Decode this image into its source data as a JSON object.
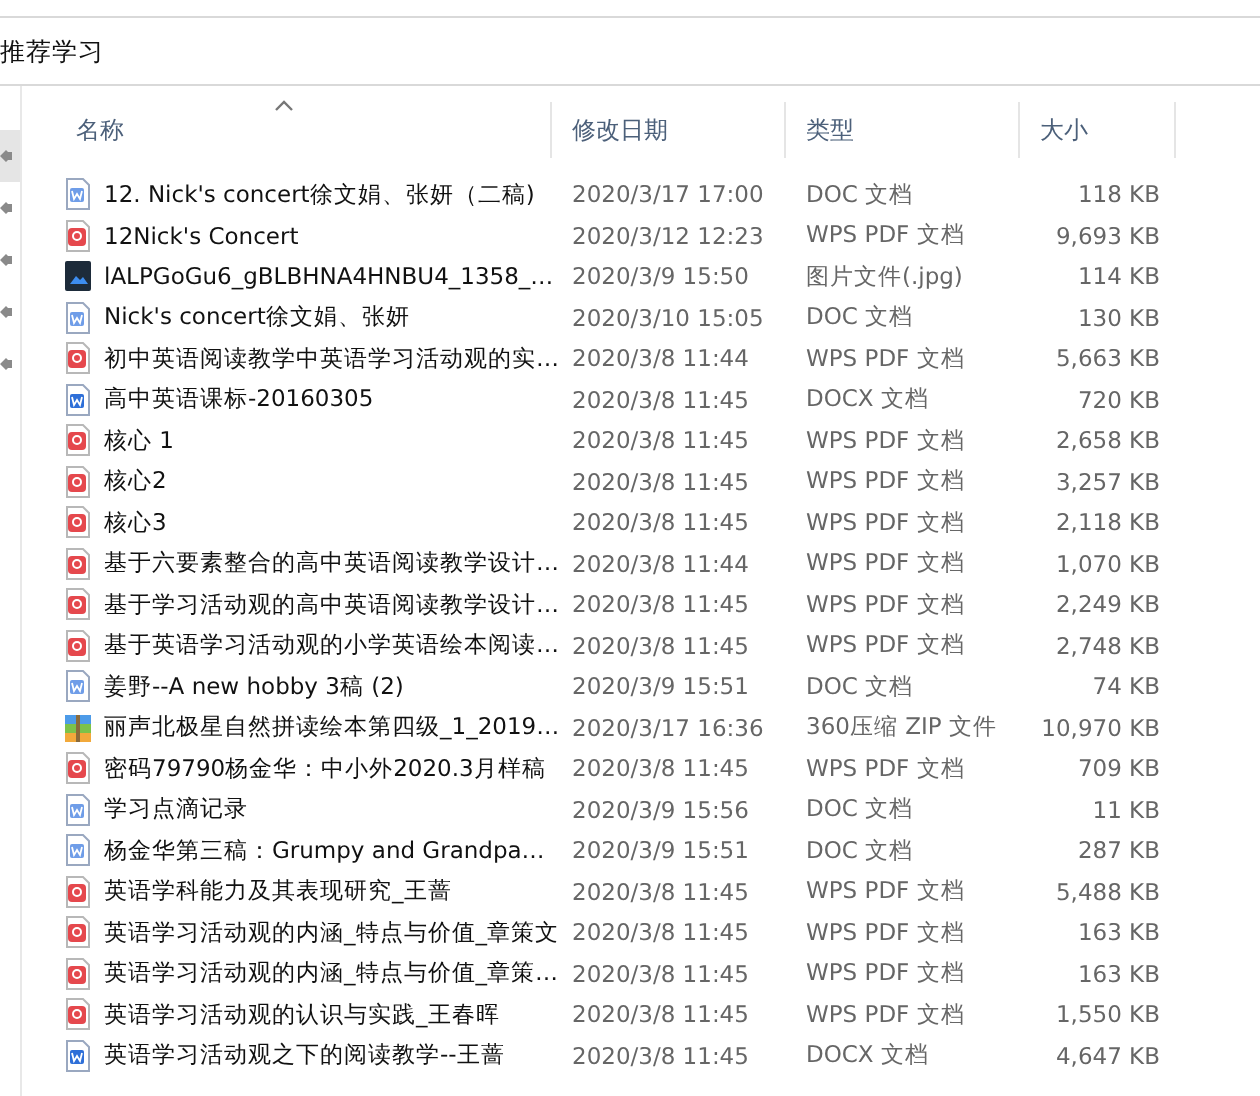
{
  "address_bar": {
    "path": "推荐学习"
  },
  "nav_pane": {
    "items": [
      {
        "selected": true
      },
      {
        "selected": false
      },
      {
        "selected": false
      },
      {
        "selected": false
      },
      {
        "selected": false
      }
    ]
  },
  "table": {
    "columns": [
      "名称",
      "修改日期",
      "类型",
      "大小"
    ],
    "rows": [
      {
        "kind": "doc",
        "name": "12. Nick's concert徐文娟、张妍（二稿)",
        "date": "2020/3/17 17:00",
        "type": "DOC 文档",
        "size": "118 KB"
      },
      {
        "kind": "pdf",
        "name": "12Nick's Concert",
        "date": "2020/3/12 12:23",
        "type": "WPS PDF 文档",
        "size": "9,693 KB"
      },
      {
        "kind": "image",
        "name": "lALPGoGu6_gBLBHNA4HNBU4_1358_…",
        "date": "2020/3/9 15:50",
        "type": "图片文件(.jpg)",
        "size": "114 KB"
      },
      {
        "kind": "doc",
        "name": "Nick's concert徐文娟、张妍",
        "date": "2020/3/10 15:05",
        "type": "DOC 文档",
        "size": "130 KB"
      },
      {
        "kind": "pdf",
        "name": "初中英语阅读教学中英语学习活动观的实…",
        "date": "2020/3/8 11:44",
        "type": "WPS PDF 文档",
        "size": "5,663 KB"
      },
      {
        "kind": "docx",
        "name": "高中英语课标-20160305",
        "date": "2020/3/8 11:45",
        "type": "DOCX 文档",
        "size": "720 KB"
      },
      {
        "kind": "pdf",
        "name": "核心 1",
        "date": "2020/3/8 11:45",
        "type": "WPS PDF 文档",
        "size": "2,658 KB"
      },
      {
        "kind": "pdf",
        "name": "核心2",
        "date": "2020/3/8 11:45",
        "type": "WPS PDF 文档",
        "size": "3,257 KB"
      },
      {
        "kind": "pdf",
        "name": "核心3",
        "date": "2020/3/8 11:45",
        "type": "WPS PDF 文档",
        "size": "2,118 KB"
      },
      {
        "kind": "pdf",
        "name": "基于六要素整合的高中英语阅读教学设计…",
        "date": "2020/3/8 11:44",
        "type": "WPS PDF 文档",
        "size": "1,070 KB"
      },
      {
        "kind": "pdf",
        "name": "基于学习活动观的高中英语阅读教学设计…",
        "date": "2020/3/8 11:45",
        "type": "WPS PDF 文档",
        "size": "2,249 KB"
      },
      {
        "kind": "pdf",
        "name": "基于英语学习活动观的小学英语绘本阅读…",
        "date": "2020/3/8 11:45",
        "type": "WPS PDF 文档",
        "size": "2,748 KB"
      },
      {
        "kind": "doc",
        "name": "姜野--A new hobby 3稿 (2)",
        "date": "2020/3/9 15:51",
        "type": "DOC 文档",
        "size": "74 KB"
      },
      {
        "kind": "zip",
        "name": "丽声北极星自然拼读绘本第四级_1_2019…",
        "date": "2020/3/17 16:36",
        "type": "360压缩 ZIP 文件",
        "size": "10,970 KB"
      },
      {
        "kind": "pdf",
        "name": "密码79790杨金华：中小外2020.3月样稿",
        "date": "2020/3/8 11:45",
        "type": "WPS PDF 文档",
        "size": "709 KB"
      },
      {
        "kind": "doc",
        "name": "学习点滴记录",
        "date": "2020/3/9 15:56",
        "type": "DOC 文档",
        "size": "11 KB"
      },
      {
        "kind": "doc",
        "name": "杨金华第三稿：Grumpy and Grandpa…",
        "date": "2020/3/9 15:51",
        "type": "DOC 文档",
        "size": "287 KB"
      },
      {
        "kind": "pdf",
        "name": "英语学科能力及其表现研究_王蔷",
        "date": "2020/3/8 11:45",
        "type": "WPS PDF 文档",
        "size": "5,488 KB"
      },
      {
        "kind": "pdf",
        "name": "英语学习活动观的内涵_特点与价值_章策文",
        "date": "2020/3/8 11:45",
        "type": "WPS PDF 文档",
        "size": "163 KB"
      },
      {
        "kind": "pdf",
        "name": "英语学习活动观的内涵_特点与价值_章策…",
        "date": "2020/3/8 11:45",
        "type": "WPS PDF 文档",
        "size": "163 KB"
      },
      {
        "kind": "pdf",
        "name": "英语学习活动观的认识与实践_王春晖",
        "date": "2020/3/8 11:45",
        "type": "WPS PDF 文档",
        "size": "1,550 KB"
      },
      {
        "kind": "docx",
        "name": "英语学习活动观之下的阅读教学--王蔷",
        "date": "2020/3/8 11:45",
        "type": "DOCX 文档",
        "size": "4,647 KB"
      }
    ]
  }
}
